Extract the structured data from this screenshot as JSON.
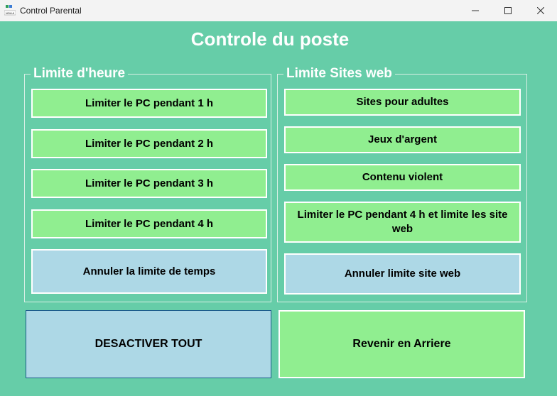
{
  "window": {
    "title": "Control Parental",
    "app_icon_text": "NOLUI",
    "minimize_icon": "minimize-icon",
    "maximize_icon": "maximize-icon",
    "close_icon": "close-icon"
  },
  "page_title": "Controle du poste",
  "colors": {
    "background": "#66cda8",
    "green_button": "#90ee90",
    "blue_button": "#add8e6"
  },
  "time_limits": {
    "legend": "Limite d'heure",
    "buttons": [
      "Limiter le PC pendant 1 h",
      "Limiter le PC pendant 2 h",
      "Limiter le PC pendant 3 h",
      "Limiter le PC pendant 4 h"
    ],
    "cancel": "Annuler la limite de temps"
  },
  "web_limits": {
    "legend": "Limite Sites web",
    "buttons": [
      "Sites pour adultes",
      "Jeux d'argent",
      "Contenu violent",
      "Limiter le PC pendant 4 h et limite les site web"
    ],
    "cancel": "Annuler limite site web"
  },
  "bottom": {
    "deactivate_all": "DESACTIVER TOUT",
    "go_back": "Revenir en Arriere"
  }
}
